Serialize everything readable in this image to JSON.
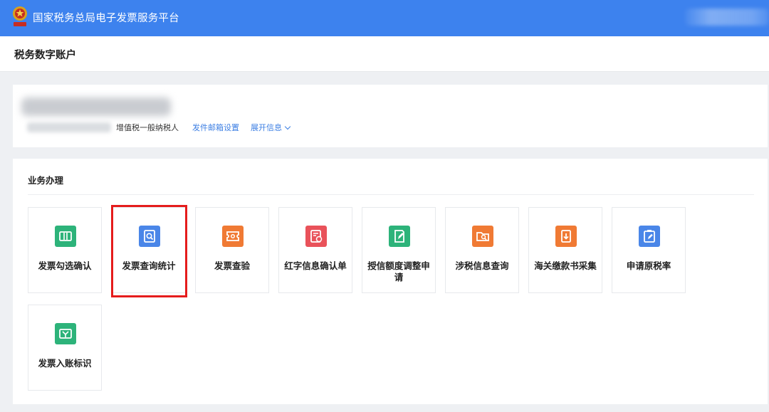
{
  "header": {
    "title": "国家税务总局电子发票服务平台",
    "emblem_icon": "tax-emblem-icon",
    "bg_color": "#3d82ee"
  },
  "breadcrumb": {
    "title": "税务数字账户"
  },
  "account": {
    "taxpayer_type": "增值税一般纳税人",
    "mail_link": "发件邮箱设置",
    "expand_link": "展开信息",
    "expand_icon": "chevron-down-icon"
  },
  "business": {
    "section_title": "业务办理",
    "tiles": [
      {
        "label": "发票勾选确认",
        "icon": "ticket-check-icon",
        "color": "#2db37a"
      },
      {
        "label": "发票查询统计",
        "icon": "invoice-search-icon",
        "color": "#4a86e8"
      },
      {
        "label": "发票查验",
        "icon": "ticket-verify-icon",
        "color": "#f07a34"
      },
      {
        "label": "红字信息确认单",
        "icon": "red-letter-doc-icon",
        "color": "#e9525a"
      },
      {
        "label": "授信额度调整申请",
        "icon": "edit-doc-icon",
        "color": "#2db37a"
      },
      {
        "label": "涉税信息查询",
        "icon": "folder-search-icon",
        "color": "#f07a34"
      },
      {
        "label": "海关缴款书采集",
        "icon": "customs-download-icon",
        "color": "#f07a34"
      },
      {
        "label": "申请原税率",
        "icon": "clipboard-edit-icon",
        "color": "#4a86e8"
      },
      {
        "label": "发票入账标识",
        "icon": "ticket-mark-icon",
        "color": "#2db37a"
      }
    ],
    "highlight_color": "#e51c1c"
  }
}
